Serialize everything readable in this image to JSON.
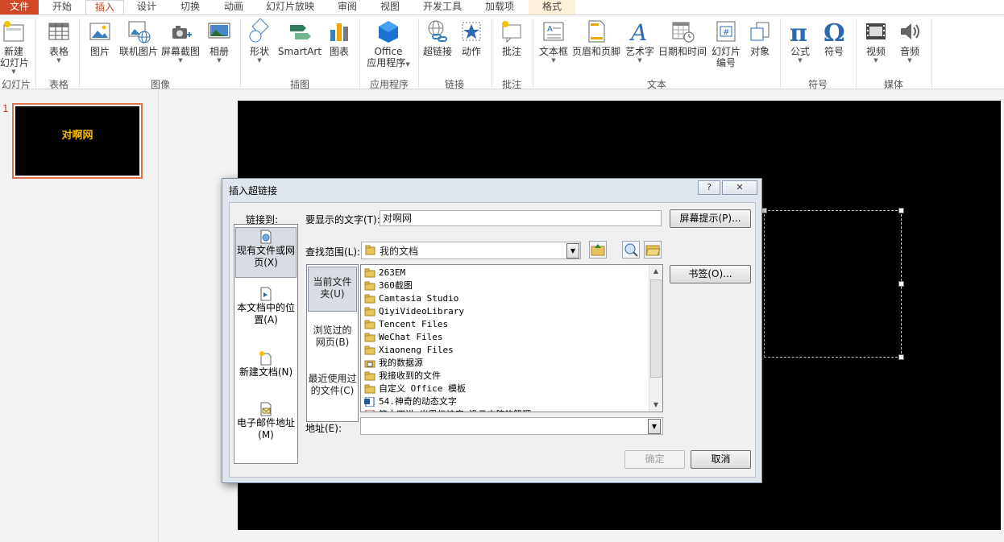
{
  "tabs": [
    "文件",
    "开始",
    "插入",
    "设计",
    "切换",
    "动画",
    "幻灯片放映",
    "审阅",
    "视图",
    "开发工具",
    "加载项",
    "格式"
  ],
  "ribbon": {
    "buttons": [
      "新建\n幻灯片",
      "表格",
      "图片",
      "联机图片",
      "屏幕截图",
      "相册",
      "形状",
      "SmartArt",
      "图表",
      "Office\n应用程序",
      "超链接",
      "动作",
      "批注",
      "文本框",
      "页眉和页脚",
      "艺术字",
      "日期和时间",
      "幻灯片\n编号",
      "对象",
      "公式",
      "符号",
      "视频",
      "音频"
    ],
    "groups": [
      "幻灯片",
      "表格",
      "图像",
      "插图",
      "应用程序",
      "链接",
      "批注",
      "文本",
      "符号",
      "媒体"
    ]
  },
  "slide_panel": {
    "number": "1",
    "thumb_text": "对啊网"
  },
  "dialog": {
    "title": "插入超链接",
    "help": "?",
    "close": "✕",
    "link_to_label": "链接到:",
    "link_options": [
      "现有文件或网\n页(X)",
      "本文档中的位\n置(A)",
      "新建文档(N)",
      "电子邮件地址\n(M)"
    ],
    "display_text_label": "要显示的文字(T):",
    "display_text_value": "对啊网",
    "screen_tip_button": "屏幕提示(P)...",
    "look_in_label": "查找范围(L):",
    "look_in_value": "我的文档",
    "bookmark_button": "书签(O)...",
    "nav_options": [
      "当前文件\n夹(U)",
      "浏览过的\n网页(B)",
      "最近使用过\n的文件(C)"
    ],
    "files": [
      {
        "name": "263EM",
        "kind": "folder"
      },
      {
        "name": "360截图",
        "kind": "folder"
      },
      {
        "name": "Camtasia Studio",
        "kind": "folder"
      },
      {
        "name": "QiyiVideoLibrary",
        "kind": "folder"
      },
      {
        "name": "Tencent Files",
        "kind": "folder"
      },
      {
        "name": "WeChat Files",
        "kind": "folder"
      },
      {
        "name": "Xiaoneng Files",
        "kind": "folder"
      },
      {
        "name": "我的数据源",
        "kind": "datasource"
      },
      {
        "name": "我接收到的文件",
        "kind": "folder"
      },
      {
        "name": "自定义 Office 模板",
        "kind": "folder"
      },
      {
        "name": "54.神奇的动态文字",
        "kind": "word"
      },
      {
        "name": "第十四讲 米思伝神座 逸云方稿的管理",
        "kind": "ppt"
      }
    ],
    "address_label": "地址(E):",
    "address_value": "",
    "ok_button": "确定",
    "cancel_button": "取消"
  }
}
